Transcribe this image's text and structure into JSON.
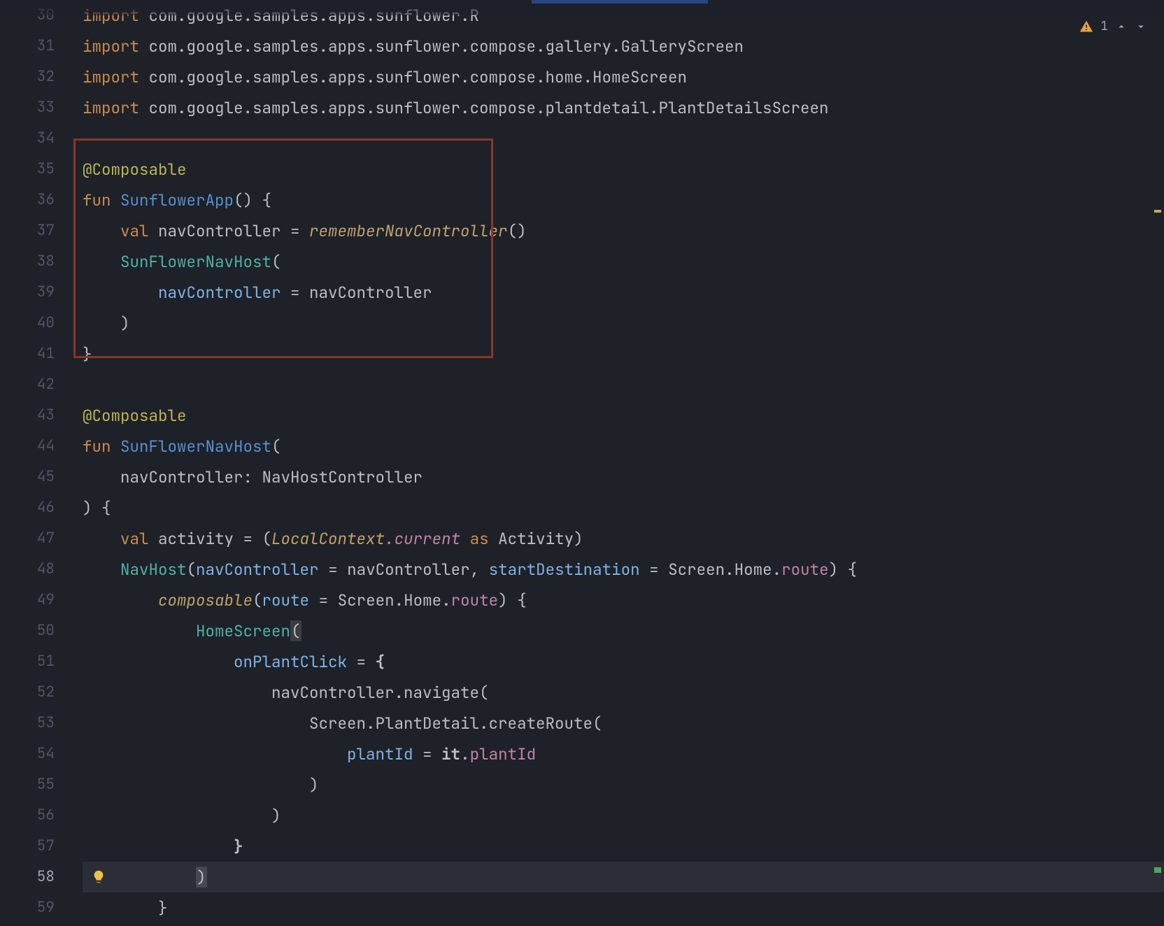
{
  "inspections": {
    "warning_count": "1"
  },
  "gutter": [
    "30",
    "31",
    "32",
    "33",
    "34",
    "35",
    "36",
    "37",
    "38",
    "39",
    "40",
    "41",
    "42",
    "43",
    "44",
    "45",
    "46",
    "47",
    "48",
    "49",
    "50",
    "51",
    "52",
    "53",
    "54",
    "55",
    "56",
    "57",
    "58",
    "59"
  ],
  "code": {
    "l30": {
      "import": "import",
      "pkg": " com.google.samples.apps.sunflower.R"
    },
    "l31": {
      "import": "import",
      "pkg": " com.google.samples.apps.sunflower.compose.gallery.GalleryScreen"
    },
    "l32": {
      "import": "import",
      "pkg": " com.google.samples.apps.sunflower.compose.home.HomeScreen"
    },
    "l33": {
      "import": "import",
      "pkg": " com.google.samples.apps.sunflower.compose.plantdetail.PlantDetailsScreen"
    },
    "l35": {
      "anno": "@Composable"
    },
    "l36": {
      "fun": "fun ",
      "name": "SunflowerApp",
      "rest": "() {"
    },
    "l37": {
      "indent": "    ",
      "val": "val ",
      "v": "navController = ",
      "call": "rememberNavController",
      "tail": "()"
    },
    "l38": {
      "indent": "    ",
      "call": "SunFlowerNavHost",
      "tail": "("
    },
    "l39": {
      "indent": "        ",
      "param": "navController",
      "eq": " = navController"
    },
    "l40": {
      "indent": "    ",
      "p": ")"
    },
    "l41": {
      "p": "}"
    },
    "l43": {
      "anno": "@Composable"
    },
    "l44": {
      "fun": "fun ",
      "name": "SunFlowerNavHost",
      "rest": "("
    },
    "l45": {
      "indent": "    ",
      "txt": "navController: NavHostController"
    },
    "l46": {
      "txt": ") {"
    },
    "l47": {
      "indent": "    ",
      "val": "val ",
      "a": "activity = (",
      "lc": "LocalContext",
      "cur": ".current",
      "as": " as ",
      "act": "Activity)"
    },
    "l48": {
      "indent": "    ",
      "nh": "NavHost",
      "open": "(",
      "p1": "navController",
      "mid": " = navController, ",
      "p2": "startDestination",
      "mid2": " = Screen.Home.",
      "rt": "route",
      "tail": ") {"
    },
    "l49": {
      "indent": "        ",
      "comp": "composable",
      "open": "(",
      "p": "route",
      "mid": " = Screen.Home.",
      "rt": "route",
      "tail": ") {"
    },
    "l50": {
      "indent": "            ",
      "hs": "HomeScreen",
      "tail": "("
    },
    "l51": {
      "indent": "                ",
      "p": "onPlantClick",
      "eq": " = ",
      "brace": "{"
    },
    "l52": {
      "indent": "                    ",
      "txt": "navController.navigate("
    },
    "l53": {
      "indent": "                        ",
      "txt": "Screen.PlantDetail.createRoute("
    },
    "l54": {
      "indent": "                            ",
      "p": "plantId",
      "eq": " = ",
      "it": "it",
      "dot": ".",
      "pid": "plantId"
    },
    "l55": {
      "indent": "                        ",
      ")": ")"
    },
    "l56": {
      "indent": "                    ",
      ")": ")"
    },
    "l57": {
      "indent": "                ",
      "b": "}"
    },
    "l58": {
      "indent": "            ",
      ")": ")"
    },
    "l59": {
      "indent": "        ",
      "b": "}"
    }
  }
}
